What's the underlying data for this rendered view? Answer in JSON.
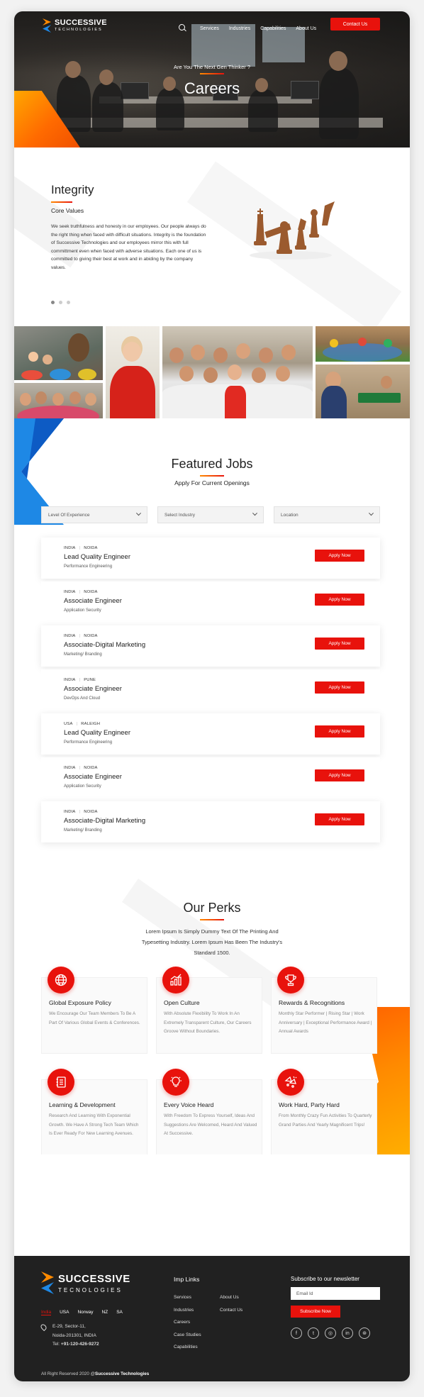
{
  "nav": {
    "logo_name": "SUCCESSIVE",
    "logo_sub": "TECHNOLOGIES",
    "links": [
      "Services",
      "Industries",
      "Capabilities",
      "About Us"
    ],
    "contact_label": "Contact Us"
  },
  "hero": {
    "subtitle": "Are You The Next Gen Thinker ?",
    "title": "Careers"
  },
  "values": {
    "title": "Integrity",
    "subtitle": "Core Values",
    "text": "We seek truthfulness and honesty in our employees. Our people always do the right thing when faced with difficult situations. Integrity is the foundation of Successive Technologies and our employees mirror this with full committment even when faced with adverse situations. Each one of us is committed to giving their best at work and in abiding by the company values."
  },
  "jobs": {
    "title": "Featured Jobs",
    "subtitle": "Apply For Current Openings",
    "filters": [
      "Level Of Experience",
      "Select Industry",
      "Location"
    ],
    "apply_label": "Apply Now",
    "items": [
      {
        "country": "INDIA",
        "city": "NOIDA",
        "title": "Lead Quality Engineer",
        "dept": "Performance Engineering"
      },
      {
        "country": "INDIA",
        "city": "NOIDA",
        "title": "Associate Engineer",
        "dept": "Application Security"
      },
      {
        "country": "INDIA",
        "city": "NOIDA",
        "title": "Associate-Digital Marketing",
        "dept": "Marketing/ Branding"
      },
      {
        "country": "INDIA",
        "city": "PUNE",
        "title": "Associate Engineer",
        "dept": "DevOps And Cloud"
      },
      {
        "country": "USA",
        "city": "RALEIGH",
        "title": "Lead Quality Engineer",
        "dept": "Performance Engineering"
      },
      {
        "country": "INDIA",
        "city": "NOIDA",
        "title": "Associate Engineer",
        "dept": "Application Security"
      },
      {
        "country": "INDIA",
        "city": "NOIDA",
        "title": "Associate-Digital Marketing",
        "dept": "Marketing/ Branding"
      }
    ]
  },
  "perks": {
    "title": "Our Perks",
    "desc": "Lorem Ipsum Is Simply Dummy Text Of The Printing And Typesetting Industry. Lorem Ipsum Has Been The Industry's Standard 1500.",
    "items": [
      {
        "icon": "globe-icon",
        "title": "Global Exposure Policy",
        "desc": "We Encourage Our Team Members To Be A Part Of Various Global Events & Conferences."
      },
      {
        "icon": "chart-growth-icon",
        "title": "Open Culture",
        "desc": "With Absolute Flexibility To Work In An Extremely Transparent Culture, Our Careers Groove Without Boundaries."
      },
      {
        "icon": "trophy-icon",
        "title": "Rewards & Recognitions",
        "desc": "Monthly Star Performer | Rising Star | Work Anniversary | Exceptional Performance Award | Annual Awards"
      },
      {
        "icon": "notebook-icon",
        "title": "Learning & Development",
        "desc": "Research And Learning With Exponential Growth. We Have A Strong Tech Team Which Is Ever Ready For New Learning Avenues."
      },
      {
        "icon": "lightbulb-icon",
        "title": "Every Voice Heard",
        "desc": "With Freedom To Express Yourself, Ideas And Suggestions Are Welcomed, Heard And Valued At Successive."
      },
      {
        "icon": "party-icon",
        "title": "Work Hard, Party Hard",
        "desc": "From Monthly Crazy Fun Activities To Quarterly Grand Parties And Yearly Magnificent Trips!"
      }
    ]
  },
  "footer": {
    "logo_name": "SUCCESSIVE",
    "logo_sub": "TECNOLOGIES",
    "countries": [
      "India",
      "USA",
      "Norway",
      "NZ",
      "SA"
    ],
    "address": [
      "E-29, Sector-11,",
      "Noida-201301, INDIA"
    ],
    "tel_label": "Tel: ",
    "tel": "+91-120-426-9272",
    "links_title": "Imp Links",
    "links_col1": [
      "Services",
      "Industries",
      "Careers",
      "Case Studies",
      "Capabilities"
    ],
    "links_col2": [
      "About Us",
      "Contact Us"
    ],
    "newsletter_title": "Subscribe to our newsletter",
    "email_placeholder": "Email Id",
    "subscribe_label": "Subscribe Now",
    "socials": [
      "facebook-icon",
      "twitter-icon",
      "instagram-icon",
      "linkedin-icon",
      "dribbble-icon"
    ],
    "copyright_prefix": "All Right Reserved 2020 @",
    "copyright_brand": "Successive Technologies"
  },
  "colors": {
    "accent": "#e8120c",
    "orange": "#ff8a00",
    "blue": "#1e88e5",
    "footer_bg": "#212121"
  }
}
